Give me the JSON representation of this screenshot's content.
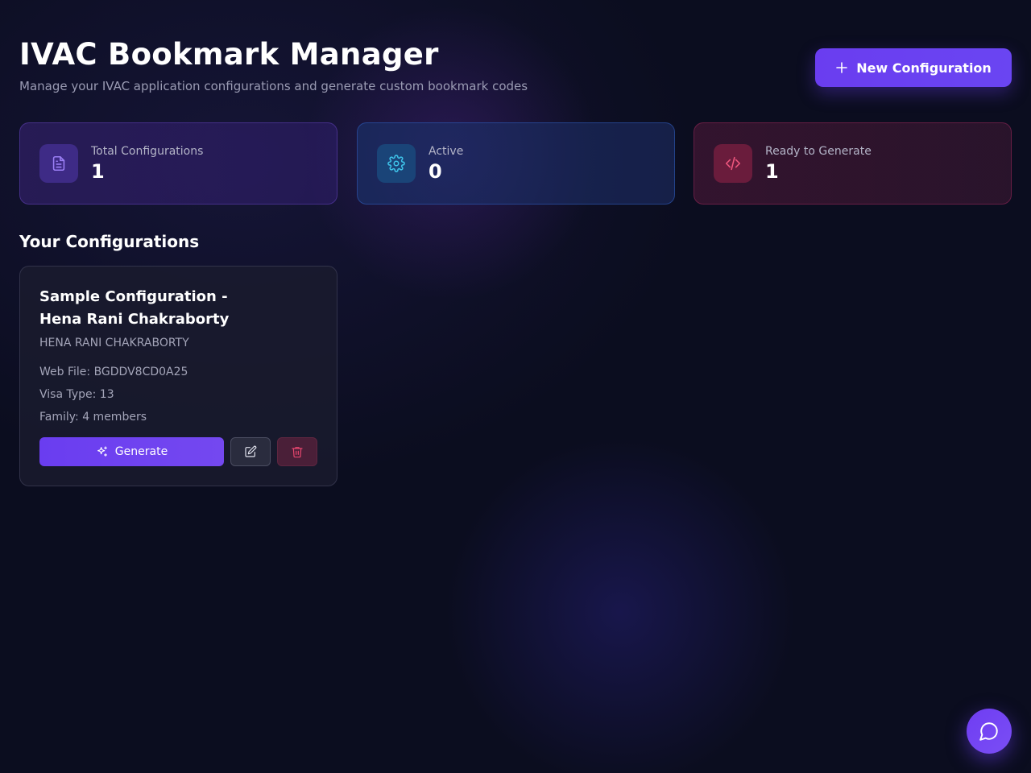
{
  "header": {
    "title": "IVAC Bookmark Manager",
    "subtitle": "Manage your IVAC application configurations and generate custom bookmark codes",
    "new_button_label": "New Configuration"
  },
  "stats": [
    {
      "label": "Total Configurations",
      "value": "1",
      "icon": "document-icon",
      "accent": "#8b6cf0"
    },
    {
      "label": "Active",
      "value": "0",
      "icon": "gear-icon",
      "accent": "#3ec2e8"
    },
    {
      "label": "Ready to Generate",
      "value": "1",
      "icon": "code-icon",
      "accent": "#e6466e"
    }
  ],
  "section": {
    "title": "Your Configurations"
  },
  "configurations": [
    {
      "title": "Sample Configuration - Hena Rani Chakraborty",
      "applicant": "HENA RANI CHAKRABORTY",
      "web_file": "Web File: BGDDV8CD0A25",
      "visa_type": "Visa Type: 13",
      "family": "Family: 4 members",
      "generate_label": "Generate"
    }
  ],
  "colors": {
    "primary": "#6a3df0",
    "background": "#0b0d1f",
    "muted_text": "#a3a4b8",
    "danger": "#e6466e"
  }
}
